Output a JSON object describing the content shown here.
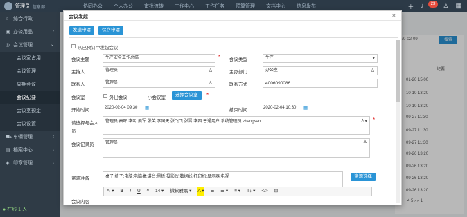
{
  "topbar": {
    "user_name": "管理员",
    "user_sub": "信息部",
    "menu": [
      "协同办公",
      "个人办公",
      "审批流转",
      "工作中心",
      "工作任务",
      "预算管理",
      "文档中心",
      "信息发布"
    ],
    "badge": "23",
    "icons": [
      "plus-icon",
      "bell-icon",
      "message-icon",
      "shirt-icon",
      "grid-icon"
    ]
  },
  "sidebar": {
    "items": [
      {
        "label": "综合行政",
        "type": "top",
        "icon": "home-icon"
      },
      {
        "label": "办公用品",
        "type": "top",
        "icon": "box-icon",
        "arrow": "‹"
      },
      {
        "label": "会议管理",
        "type": "top",
        "icon": "meeting-icon",
        "arrow": "⌄"
      },
      {
        "label": "会议室占用",
        "type": "sub"
      },
      {
        "label": "会议管理",
        "type": "sub"
      },
      {
        "label": "周期会议",
        "type": "sub"
      },
      {
        "label": "会议纪要",
        "type": "sub",
        "active": true
      },
      {
        "label": "会议室预定",
        "type": "sub"
      },
      {
        "label": "会议设置",
        "type": "sub"
      },
      {
        "label": "车辆管理",
        "type": "top",
        "icon": "car-icon",
        "arrow": "‹"
      },
      {
        "label": "档案中心",
        "type": "top",
        "icon": "archive-icon",
        "arrow": "‹"
      },
      {
        "label": "印章管理",
        "type": "top",
        "icon": "seal-icon",
        "arrow": "‹"
      }
    ],
    "online": "在线 1 人"
  },
  "background": {
    "date": "2020-02-09",
    "search_btn": "搜索",
    "column_header": "纪要",
    "rows": [
      "01-20 15:00",
      "10-10 13:20",
      "10-10 13:20",
      "09-27 11:30",
      "09-27 11:30",
      "09-27 11:30",
      "09-26 13:20",
      "09-26 13:20",
      "09-26 13:20",
      "09-26 13:20"
    ],
    "pager": "4  5  ›  »     1"
  },
  "modal": {
    "title": "会议发起",
    "close": "×",
    "send_btn": "发送申请",
    "save_btn": "保存申请",
    "from_booked": "从已预订中发起会议",
    "fields": {
      "subject_label": "会议主题",
      "subject_value": "生产安全工作总结",
      "type_label": "会议类型",
      "type_value": "生产",
      "host_label": "主持人",
      "host_value": "管理员",
      "dept_label": "主办部门",
      "dept_value": "办公室",
      "contact_label": "联系人",
      "contact_value": "管理员",
      "phone_label": "联系方式",
      "phone_value": "4006090086",
      "room_label": "会议室",
      "outside_label": "外出会议",
      "room_value": "小会议室",
      "choose_room_btn": "选择会议室",
      "start_label": "开始时间",
      "start_value": "2020-02-04 09:30",
      "end_label": "结束时间",
      "end_value": "2020-02-04 10:30",
      "attendees_label_1": "请选择与会人",
      "attendees_label_2": "员",
      "attendees_value": "管理员  秦晖  李明  姜军  张英  李国天  张飞飞  张晋  李四  普通用户  系统管理员  zhangsan",
      "recorder_label": "会议记录员",
      "recorder_value": "管理员",
      "resources_label": "资源准备",
      "resources_value": "桌子;椅子;电脑;电脑桌;讲台;黑板;投影仪;数据线;打印机;显示器;电视",
      "resources_btn": "资源选择",
      "content_label": "会议内容"
    },
    "toolbar": [
      "✎ ▾",
      "B",
      "I",
      "U",
      "ꭩ",
      "14 ▾",
      "微软雅黑 ▾",
      "A ▾",
      "☰",
      "☰ ▾",
      "≡ ▾",
      "T↕ ▾",
      "</>",
      "⊞"
    ]
  }
}
